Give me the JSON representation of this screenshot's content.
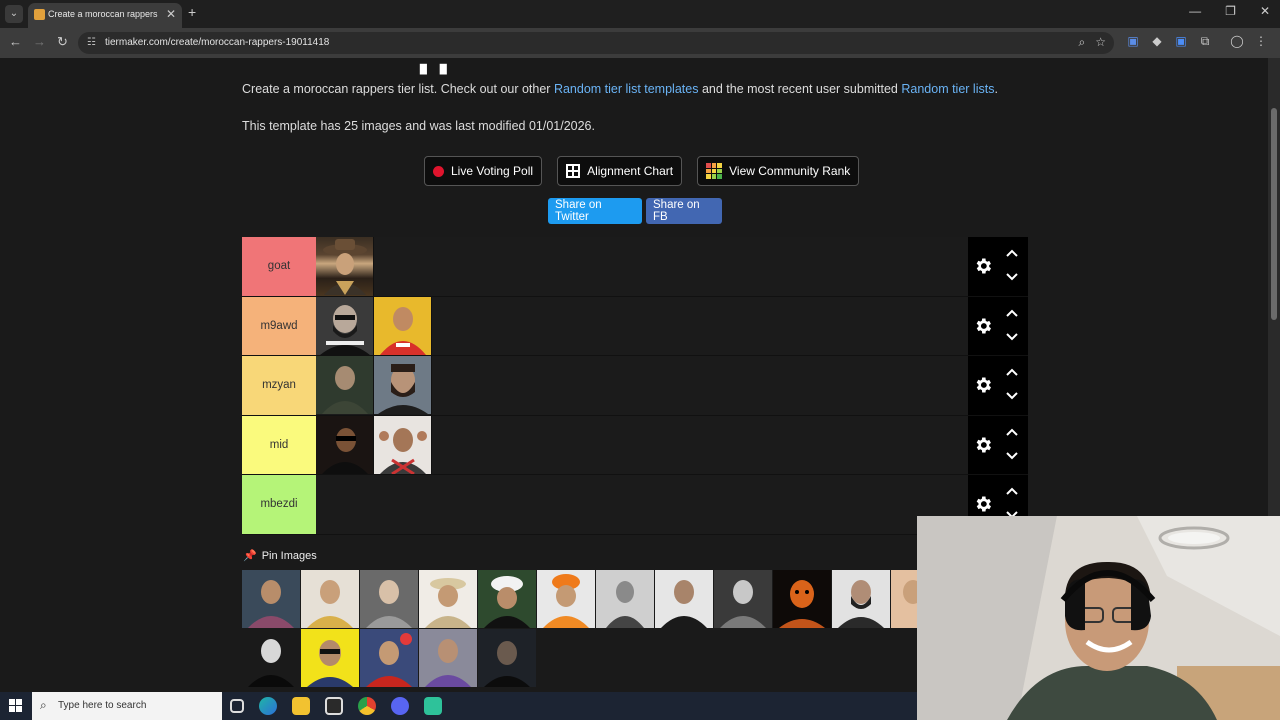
{
  "browser": {
    "tab_title": "Create a moroccan rappers Tier",
    "tab_close": "✕",
    "new_tab": "+",
    "url": "tiermaker.com/create/moroccan-rappers-19011418",
    "minimize": "—",
    "restore": "❐",
    "close": "✕"
  },
  "page": {
    "intro_prefix": "Create a moroccan rappers tier list. Check out our other ",
    "intro_link1": "Random tier list templates",
    "intro_middle": " and the most recent user submitted ",
    "intro_link2": "Random tier lists",
    "intro_suffix": ".",
    "template_info": "This template has 25 images and was last modified 01/01/2026.",
    "live_voting_label": "Live Voting Poll",
    "alignment_label": "Alignment Chart",
    "community_rank_label": "View Community Rank",
    "share_twitter_label": "Share on Twitter",
    "share_fb_label": "Share on FB",
    "pin_label": "Pin Images"
  },
  "tiers": [
    {
      "label": "goat",
      "color": "#f07577",
      "items": 1
    },
    {
      "label": "m9awd",
      "color": "#f5b27a",
      "items": 2
    },
    {
      "label": "mzyan",
      "color": "#f8d778",
      "items": 2
    },
    {
      "label": "mid",
      "color": "#fafa7d",
      "items": 2
    },
    {
      "label": "mbezdi",
      "color": "#b5f478",
      "items": 0
    }
  ],
  "taskbar": {
    "search_placeholder": "Type here to search"
  },
  "colors": {
    "link": "#6ab3f5",
    "twitter": "#1d9bf0",
    "facebook": "#4267b2",
    "live_dot": "#e0142d"
  }
}
